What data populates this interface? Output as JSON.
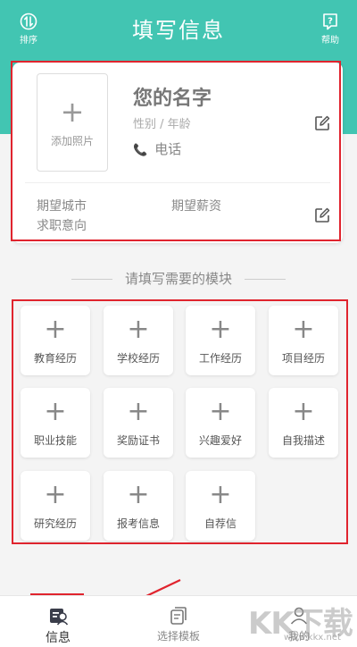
{
  "header": {
    "title": "填写信息",
    "left_label": "排序",
    "right_label": "帮助",
    "bg_color": "#42c5b2"
  },
  "card": {
    "photo_label": "添加照片",
    "name": "您的名字",
    "gender_age": "性别 / 年龄",
    "phone": "电话",
    "city": "期望城市",
    "salary": "期望薪资",
    "intent": "求职意向"
  },
  "section_title": "请填写需要的模块",
  "modules": [
    {
      "label": "教育经历"
    },
    {
      "label": "学校经历"
    },
    {
      "label": "工作经历"
    },
    {
      "label": "项目经历"
    },
    {
      "label": "职业技能"
    },
    {
      "label": "奖励证书"
    },
    {
      "label": "兴趣爱好"
    },
    {
      "label": "自我描述"
    },
    {
      "label": "研究经历"
    },
    {
      "label": "报考信息"
    },
    {
      "label": "自荐信"
    }
  ],
  "tabs": [
    {
      "label": "信息",
      "active": true
    },
    {
      "label": "选择模板",
      "active": false
    },
    {
      "label": "我的",
      "active": false
    }
  ],
  "watermark": {
    "big": "KK下载",
    "small": "www.kkx.net"
  },
  "annotation_color": "#e0242e"
}
